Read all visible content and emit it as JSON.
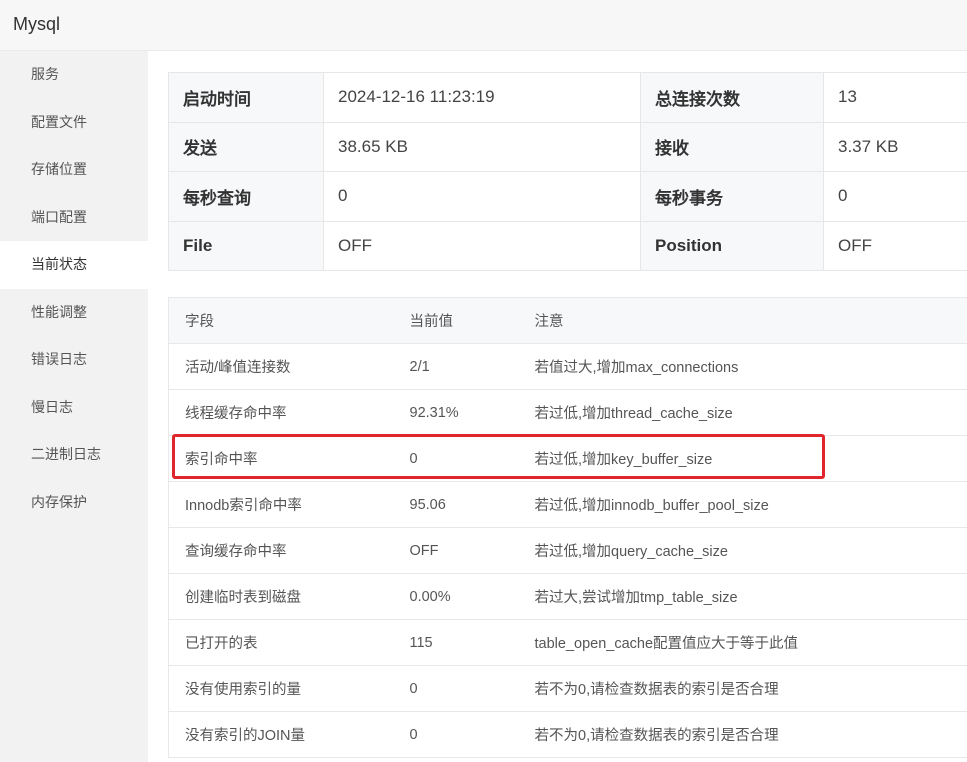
{
  "app": {
    "title": "Mysql"
  },
  "sidebar": {
    "items": [
      {
        "label": "服务"
      },
      {
        "label": "配置文件"
      },
      {
        "label": "存储位置"
      },
      {
        "label": "端口配置"
      },
      {
        "label": "当前状态",
        "active": true
      },
      {
        "label": "性能调整"
      },
      {
        "label": "错误日志"
      },
      {
        "label": "慢日志"
      },
      {
        "label": "二进制日志"
      },
      {
        "label": "内存保护"
      }
    ]
  },
  "summary": {
    "rows": [
      {
        "k1": "启动时间",
        "v1": "2024-12-16 11:23:19",
        "k2": "总连接次数",
        "v2": "13"
      },
      {
        "k1": "发送",
        "v1": "38.65 KB",
        "k2": "接收",
        "v2": "3.37 KB"
      },
      {
        "k1": "每秒查询",
        "v1": "0",
        "k2": "每秒事务",
        "v2": "0"
      },
      {
        "k1": "File",
        "v1": "OFF",
        "k2": "Position",
        "v2": "OFF"
      }
    ]
  },
  "fields": {
    "headers": {
      "field": "字段",
      "value": "当前值",
      "note": "注意"
    },
    "rows": [
      {
        "field": "活动/峰值连接数",
        "value": "2/1",
        "note": "若值过大,增加max_connections"
      },
      {
        "field": "线程缓存命中率",
        "value": "92.31%",
        "note": "若过低,增加thread_cache_size"
      },
      {
        "field": "索引命中率",
        "value": "0",
        "note": "若过低,增加key_buffer_size"
      },
      {
        "field": "Innodb索引命中率",
        "value": "95.06",
        "note": "若过低,增加innodb_buffer_pool_size"
      },
      {
        "field": "查询缓存命中率",
        "value": "OFF",
        "note": "若过低,增加query_cache_size"
      },
      {
        "field": "创建临时表到磁盘",
        "value": "0.00%",
        "note": "若过大,尝试增加tmp_table_size"
      },
      {
        "field": "已打开的表",
        "value": "115",
        "note": "table_open_cache配置值应大于等于此值"
      },
      {
        "field": "没有使用索引的量",
        "value": "0",
        "note": "若不为0,请检查数据表的索引是否合理"
      },
      {
        "field": "没有索引的JOIN量",
        "value": "0",
        "note": "若不为0,请检查数据表的索引是否合理"
      }
    ]
  },
  "highlight": {
    "color": "#e0262c"
  }
}
